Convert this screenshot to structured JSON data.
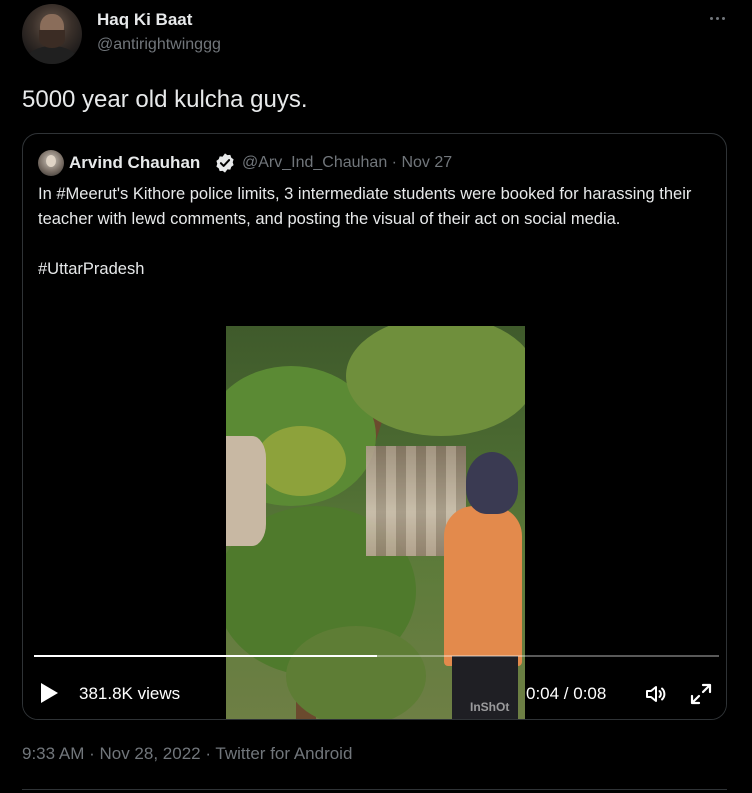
{
  "tweet": {
    "author_name": "Haq Ki Baat",
    "author_handle": "@antirightwinggg",
    "text": "5000 year old kulcha guys.",
    "more_icon": "ellipsis-icon",
    "meta": "9:33 AM · Nov 28, 2022 · Twitter for Android"
  },
  "quote": {
    "author_name": "Arvind Chauhan",
    "verified_icon": "verified-badge-icon",
    "handle_date": "@Arv_Ind_Chauhan · Nov 27",
    "body": "In #Meerut's Kithore police limits, 3 intermediate students were booked for harassing their teacher with lewd comments, and posting the visual of their act on social media.",
    "hashtag": "#UttarPradesh"
  },
  "video": {
    "views": "381.8K views",
    "time": "0:04 / 0:08",
    "progress": 0.5,
    "watermark": "InShOt",
    "play_icon": "play-icon",
    "volume_icon": "volume-icon",
    "fullscreen_icon": "fullscreen-icon"
  },
  "colors": {
    "background": "#000000",
    "text": "#e7e9ea",
    "secondary": "#71767b",
    "border": "#2f3336",
    "verified": "#e7e9ea"
  }
}
